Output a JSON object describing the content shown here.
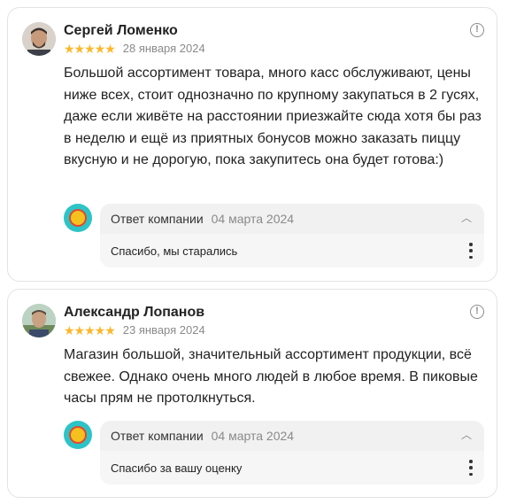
{
  "reviews": [
    {
      "author": "Сергей Ломенко",
      "stars": "★★★★★",
      "rating": 5,
      "date": "28 января 2024",
      "text": "Большой ассортимент товара, много касс обслуживают, цены ниже всех, стоит однозначно по крупному закупаться в 2 гусях, даже если живёте на расстоянии приезжайте сюда хотя бы раз в неделю и ещё из приятных бонусов можно заказать пиццу вкусную и не дорогую, пока закупитесь она будет готова:)",
      "reply": {
        "title": "Ответ компании",
        "date": "04 марта 2024",
        "text": "Спасибо, мы старались"
      }
    },
    {
      "author": "Александр Лопанов",
      "stars": "★★★★★",
      "rating": 5,
      "date": "23 января 2024",
      "text": "Магазин большой, значительный ассортимент продукции, всё свежее. Однако очень много людей в любое время. В пиковые часы прям не протолкнуться.",
      "reply": {
        "title": "Ответ компании",
        "date": "04 марта 2024",
        "text": "Спасибо за вашу оценку"
      }
    }
  ],
  "icons": {
    "info": "info-icon",
    "collapse": "chevron-up-icon",
    "more": "more-vertical-icon"
  },
  "colors": {
    "star": "#fcb72a",
    "logo_bg": "#2cc4c7"
  }
}
